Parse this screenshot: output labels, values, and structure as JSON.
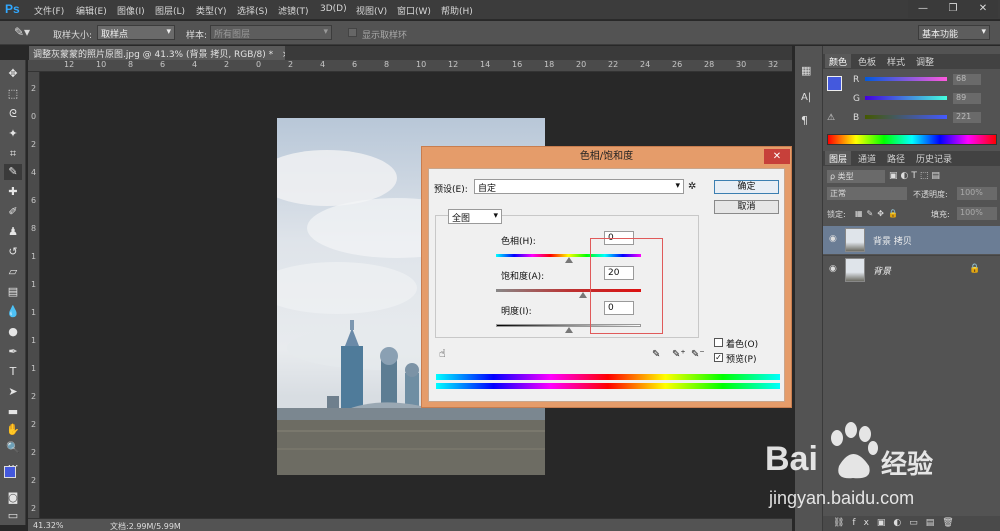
{
  "app": {
    "logo": "Ps"
  },
  "menu": [
    "文件(F)",
    "编辑(E)",
    "图像(I)",
    "图层(L)",
    "类型(Y)",
    "选择(S)",
    "滤镜(T)",
    "3D(D)",
    "视图(V)",
    "窗口(W)",
    "帮助(H)"
  ],
  "window_controls": {
    "minimize": "—",
    "restore": "❐",
    "close": "✕"
  },
  "options": {
    "sample_size_label": "取样大小:",
    "sample_size_value": "取样点",
    "sample_label": "样本:",
    "sample_value": "所有图层",
    "show_ring_label": "显示取样环",
    "workspace": "基本功能"
  },
  "document": {
    "tab_title": "调整灰蒙蒙的照片原图.jpg @ 41.3% (背景 拷贝, RGB/8) *",
    "tab_close": "×",
    "zoom": "41.32%",
    "doc_info": "文档:2.99M/5.99M"
  },
  "ruler_top": [
    "12",
    "10",
    "8",
    "6",
    "4",
    "2",
    "0",
    "2",
    "4",
    "6",
    "8",
    "10",
    "12",
    "14",
    "16",
    "18",
    "20",
    "22",
    "24",
    "26",
    "28",
    "30",
    "32",
    "34"
  ],
  "ruler_left": [
    "2",
    "0",
    "2",
    "4",
    "6",
    "8",
    "1",
    "1",
    "1",
    "1",
    "1",
    "2",
    "2",
    "2",
    "2",
    "2"
  ],
  "color_panel": {
    "tabs": [
      "颜色",
      "色板",
      "样式",
      "调整"
    ],
    "r_label": "R",
    "r_value": "68",
    "g_label": "G",
    "g_value": "89",
    "b_label": "B",
    "b_value": "221",
    "fg_color": "#4459dd"
  },
  "layers_panel": {
    "tabs": [
      "图层",
      "通道",
      "路径",
      "历史记录"
    ],
    "filter_label": "ρ 类型",
    "blend_mode": "正常",
    "opacity_label": "不透明度:",
    "opacity_value": "100%",
    "lock_label": "锁定:",
    "fill_label": "填充:",
    "fill_value": "100%",
    "layers": [
      {
        "name": "背景 拷贝",
        "selected": true
      },
      {
        "name": "背景",
        "selected": false,
        "italic": true
      }
    ]
  },
  "dialog": {
    "title": "色相/饱和度",
    "close": "✕",
    "preset_label": "预设(E):",
    "preset_value": "自定",
    "ok": "确定",
    "cancel": "取消",
    "channel": "全图",
    "hue_label": "色相(H):",
    "hue_value": "0",
    "saturation_label": "饱和度(A):",
    "saturation_value": "20",
    "lightness_label": "明度(I):",
    "lightness_value": "0",
    "colorize_label": "着色(O)",
    "colorize_checked": false,
    "preview_label": "预览(P)",
    "preview_checked": true
  },
  "watermark": {
    "brand": "Bai",
    "brand2": "经验",
    "url": "jingyan.baidu.com"
  }
}
